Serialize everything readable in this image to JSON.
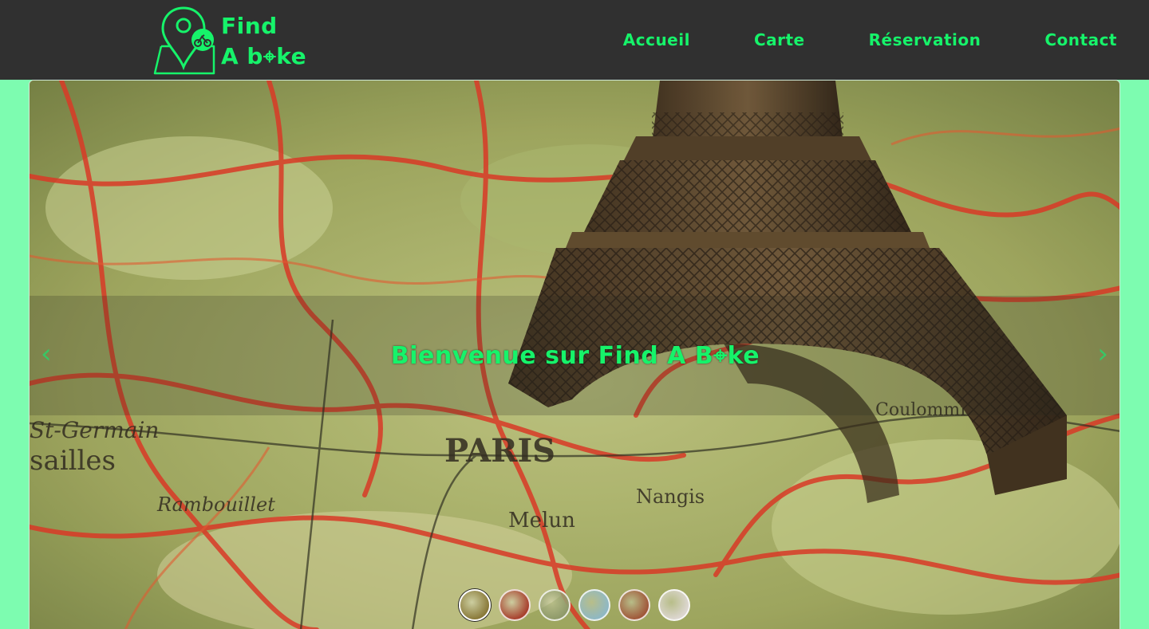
{
  "header": {
    "logo": {
      "line1": "Find",
      "line2": "A b⌖ke"
    },
    "nav": [
      {
        "label": "Accueil"
      },
      {
        "label": "Carte"
      },
      {
        "label": "Réservation"
      },
      {
        "label": "Contact"
      }
    ]
  },
  "carousel": {
    "caption": "Bienvenue sur Find A B⌖ke",
    "prev_icon": "‹",
    "next_icon": "›",
    "active_index": 0,
    "thumbnails": [
      {
        "name": "eiffel-tower-map",
        "color": "#8a7a3a"
      },
      {
        "name": "red-city",
        "color": "#a8412e"
      },
      {
        "name": "green-texture",
        "color": "#8f9a6a"
      },
      {
        "name": "sky-scene",
        "color": "#8fb8c4"
      },
      {
        "name": "desert-scene",
        "color": "#a0583a"
      },
      {
        "name": "pale-scene",
        "color": "#dcd6d0"
      }
    ]
  },
  "colors": {
    "accent": "#16f36a",
    "header_bg": "#303030",
    "page_bg": "#7dfcb0"
  }
}
